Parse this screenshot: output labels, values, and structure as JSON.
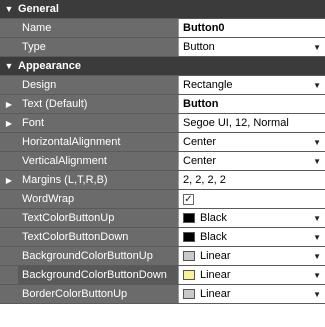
{
  "grid": {
    "rows": [
      {
        "kind": "category",
        "label": "General"
      },
      {
        "kind": "prop",
        "name": "Name",
        "value": "Button0",
        "bold": true
      },
      {
        "kind": "prop",
        "name": "Type",
        "value": "Button",
        "dropdown": true
      },
      {
        "kind": "category",
        "label": "Appearance"
      },
      {
        "kind": "prop",
        "name": "Design",
        "value": "Rectangle",
        "dropdown": true
      },
      {
        "kind": "prop",
        "name": "Text (Default)",
        "value": "Button",
        "bold": true,
        "expandable": true
      },
      {
        "kind": "prop",
        "name": "Font",
        "value": "Segoe UI, 12, Normal",
        "expandable": true
      },
      {
        "kind": "prop",
        "name": "HorizontalAlignment",
        "value": "Center",
        "dropdown": true
      },
      {
        "kind": "prop",
        "name": "VerticalAlignment",
        "value": "Center",
        "dropdown": true
      },
      {
        "kind": "prop",
        "name": "Margins (L,T,R,B)",
        "value": "2, 2, 2, 2",
        "expandable": true
      },
      {
        "kind": "prop",
        "name": "WordWrap",
        "checkbox": true,
        "checked": true
      },
      {
        "kind": "prop",
        "name": "TextColorButtonUp",
        "value": "Black",
        "swatch": "#000000",
        "dropdown": true
      },
      {
        "kind": "prop",
        "name": "TextColorButtonDown",
        "value": "Black",
        "swatch": "#000000",
        "dropdown": true
      },
      {
        "kind": "prop",
        "name": "BackgroundColorButtonUp",
        "value": "Linear",
        "swatch": "#c8c8c8",
        "dropdown": true
      },
      {
        "kind": "prop",
        "name": "BackgroundColorButtonDown",
        "value": "Linear",
        "swatch": "#f7f19a",
        "dropdown": true,
        "selected": true
      },
      {
        "kind": "prop",
        "name": "BorderColorButtonUp",
        "value": "Linear",
        "swatch": "#c8c8c8",
        "dropdown": true
      }
    ]
  },
  "icons": {
    "expanded": "▼",
    "collapsed": "▶",
    "dropdown": "▼",
    "check": "✓"
  }
}
